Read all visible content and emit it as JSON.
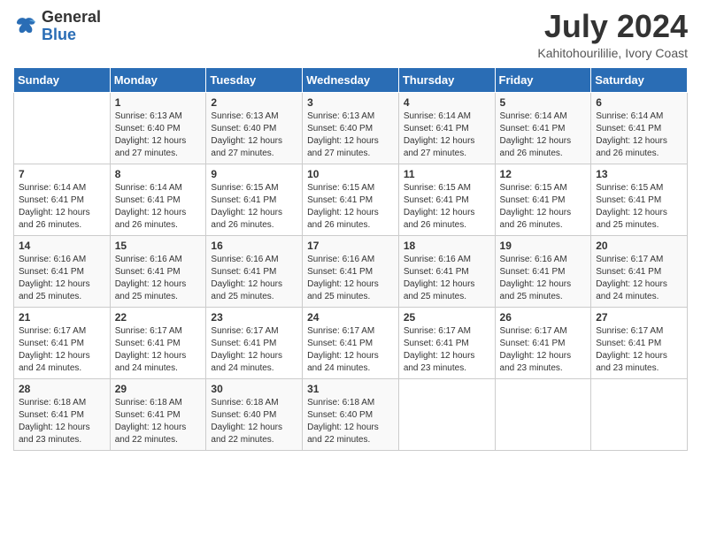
{
  "logo": {
    "general": "General",
    "blue": "Blue"
  },
  "title": "July 2024",
  "location": "Kahitohourililie, Ivory Coast",
  "days_of_week": [
    "Sunday",
    "Monday",
    "Tuesday",
    "Wednesday",
    "Thursday",
    "Friday",
    "Saturday"
  ],
  "weeks": [
    [
      {
        "day": "",
        "info": ""
      },
      {
        "day": "1",
        "info": "Sunrise: 6:13 AM\nSunset: 6:40 PM\nDaylight: 12 hours\nand 27 minutes."
      },
      {
        "day": "2",
        "info": "Sunrise: 6:13 AM\nSunset: 6:40 PM\nDaylight: 12 hours\nand 27 minutes."
      },
      {
        "day": "3",
        "info": "Sunrise: 6:13 AM\nSunset: 6:40 PM\nDaylight: 12 hours\nand 27 minutes."
      },
      {
        "day": "4",
        "info": "Sunrise: 6:14 AM\nSunset: 6:41 PM\nDaylight: 12 hours\nand 27 minutes."
      },
      {
        "day": "5",
        "info": "Sunrise: 6:14 AM\nSunset: 6:41 PM\nDaylight: 12 hours\nand 26 minutes."
      },
      {
        "day": "6",
        "info": "Sunrise: 6:14 AM\nSunset: 6:41 PM\nDaylight: 12 hours\nand 26 minutes."
      }
    ],
    [
      {
        "day": "7",
        "info": ""
      },
      {
        "day": "8",
        "info": "Sunrise: 6:14 AM\nSunset: 6:41 PM\nDaylight: 12 hours\nand 26 minutes."
      },
      {
        "day": "9",
        "info": "Sunrise: 6:15 AM\nSunset: 6:41 PM\nDaylight: 12 hours\nand 26 minutes."
      },
      {
        "day": "10",
        "info": "Sunrise: 6:15 AM\nSunset: 6:41 PM\nDaylight: 12 hours\nand 26 minutes."
      },
      {
        "day": "11",
        "info": "Sunrise: 6:15 AM\nSunset: 6:41 PM\nDaylight: 12 hours\nand 26 minutes."
      },
      {
        "day": "12",
        "info": "Sunrise: 6:15 AM\nSunset: 6:41 PM\nDaylight: 12 hours\nand 26 minutes."
      },
      {
        "day": "13",
        "info": "Sunrise: 6:15 AM\nSunset: 6:41 PM\nDaylight: 12 hours\nand 25 minutes."
      }
    ],
    [
      {
        "day": "14",
        "info": ""
      },
      {
        "day": "15",
        "info": "Sunrise: 6:16 AM\nSunset: 6:41 PM\nDaylight: 12 hours\nand 25 minutes."
      },
      {
        "day": "16",
        "info": "Sunrise: 6:16 AM\nSunset: 6:41 PM\nDaylight: 12 hours\nand 25 minutes."
      },
      {
        "day": "17",
        "info": "Sunrise: 6:16 AM\nSunset: 6:41 PM\nDaylight: 12 hours\nand 25 minutes."
      },
      {
        "day": "18",
        "info": "Sunrise: 6:16 AM\nSunset: 6:41 PM\nDaylight: 12 hours\nand 25 minutes."
      },
      {
        "day": "19",
        "info": "Sunrise: 6:16 AM\nSunset: 6:41 PM\nDaylight: 12 hours\nand 25 minutes."
      },
      {
        "day": "20",
        "info": "Sunrise: 6:17 AM\nSunset: 6:41 PM\nDaylight: 12 hours\nand 24 minutes."
      }
    ],
    [
      {
        "day": "21",
        "info": ""
      },
      {
        "day": "22",
        "info": "Sunrise: 6:17 AM\nSunset: 6:41 PM\nDaylight: 12 hours\nand 24 minutes."
      },
      {
        "day": "23",
        "info": "Sunrise: 6:17 AM\nSunset: 6:41 PM\nDaylight: 12 hours\nand 24 minutes."
      },
      {
        "day": "24",
        "info": "Sunrise: 6:17 AM\nSunset: 6:41 PM\nDaylight: 12 hours\nand 24 minutes."
      },
      {
        "day": "25",
        "info": "Sunrise: 6:17 AM\nSunset: 6:41 PM\nDaylight: 12 hours\nand 23 minutes."
      },
      {
        "day": "26",
        "info": "Sunrise: 6:17 AM\nSunset: 6:41 PM\nDaylight: 12 hours\nand 23 minutes."
      },
      {
        "day": "27",
        "info": "Sunrise: 6:17 AM\nSunset: 6:41 PM\nDaylight: 12 hours\nand 23 minutes."
      }
    ],
    [
      {
        "day": "28",
        "info": "Sunrise: 6:18 AM\nSunset: 6:41 PM\nDaylight: 12 hours\nand 23 minutes."
      },
      {
        "day": "29",
        "info": "Sunrise: 6:18 AM\nSunset: 6:41 PM\nDaylight: 12 hours\nand 22 minutes."
      },
      {
        "day": "30",
        "info": "Sunrise: 6:18 AM\nSunset: 6:40 PM\nDaylight: 12 hours\nand 22 minutes."
      },
      {
        "day": "31",
        "info": "Sunrise: 6:18 AM\nSunset: 6:40 PM\nDaylight: 12 hours\nand 22 minutes."
      },
      {
        "day": "",
        "info": ""
      },
      {
        "day": "",
        "info": ""
      },
      {
        "day": "",
        "info": ""
      }
    ]
  ],
  "week7_day7_info": "Daylight: 12 hours\nand 26 minutes.",
  "week14_day_info": "Daylight: 12 hours\nand 25 minutes.",
  "week21_day_info": "Daylight: 12 hours\nand 24 minutes."
}
